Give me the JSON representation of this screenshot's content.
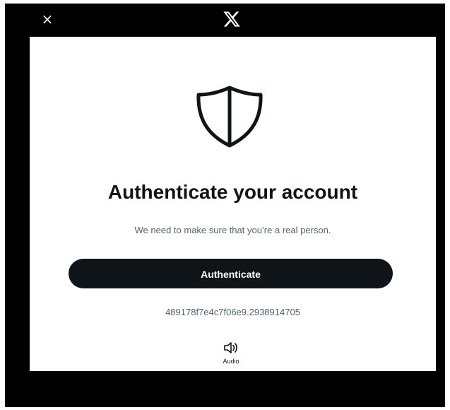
{
  "window": {
    "close_glyph": "×",
    "logo": "x-logo-icon"
  },
  "dialog": {
    "icon": "shield-icon",
    "title": "Authenticate your account",
    "subtitle": "We need to make sure that you’re a real person.",
    "primary_button_label": "Authenticate",
    "session_id": "489178f7e4c7f06e9.2938914705",
    "audio_icon": "speaker-icon",
    "audio_label": "Audio"
  },
  "colors": {
    "backdrop": "#000000",
    "card": "#ffffff",
    "button": "#0f1419",
    "text_primary": "#0f1419",
    "text_secondary": "#536471"
  }
}
